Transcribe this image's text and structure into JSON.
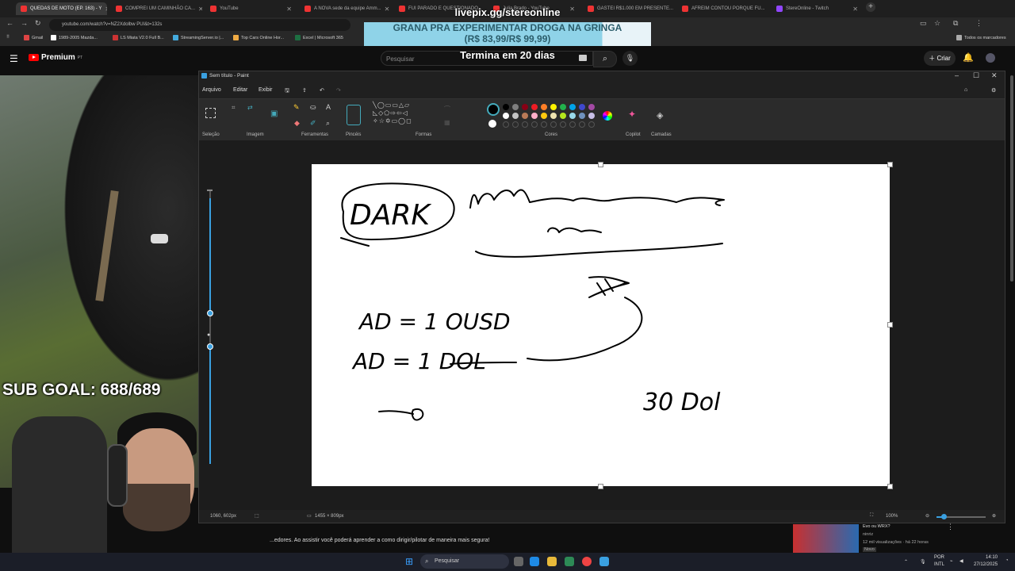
{
  "browser": {
    "tabs": [
      {
        "label": "QUEDAS DE MOTO (EP. 163) - Y",
        "active": true
      },
      {
        "label": "COMPREI UM CAMINHÃO CA...",
        "active": false
      },
      {
        "label": "YouTube",
        "active": false
      },
      {
        "label": "A NOVA sede da equipe Amm...",
        "active": false
      },
      {
        "label": "FUI PARADO E QUESTIONADO...",
        "active": false
      },
      {
        "label": "Julia Brado - YouTube",
        "active": false
      },
      {
        "label": "GASTEI R$1.000 EM PRESENTE...",
        "active": false
      },
      {
        "label": "AFREIM CONTOU PORQUE FU...",
        "active": false
      },
      {
        "label": "StereOnline - Twitch",
        "active": false
      }
    ],
    "url": "youtube.com/watch?v=NZ2Xdolbw PUI&t=132s",
    "bookmarks": [
      "Gmail",
      "1989-2005 Mazda...",
      "LS Miata V2.0 Full B...",
      "StreamingServer.io |...",
      "Top Cars Online Hor...",
      "Excel | Microsoft 365"
    ],
    "bookmarks_all": "Todos os marcadores"
  },
  "youtube": {
    "logo": "Premium",
    "logo_region": "PT",
    "search_placeholder": "Pesquisar",
    "create_label": "Criar",
    "description_snippet": "...edores. Ao assistir você poderá aprender a como dirigir/pilotar de maneira mais segura!",
    "recommended": {
      "title": "Evo ou WRX?",
      "channel": "ninriz",
      "meta": "12 mil visualizações · há 22 horas",
      "badge": "Novo"
    }
  },
  "stream_overlay": {
    "livepix": "livepix.gg/stereonline",
    "banner_line1": "GRANA PRA EXPERIMENTAR DROGA NA GRINGA",
    "banner_line2": "(R$ 83,99/R$ 99,99)",
    "countdown": "Termina em 20 dias",
    "sub_goal": "SUB GOAL: 688/689"
  },
  "paint": {
    "title": "Sem título - Paint",
    "menu": [
      "Arquivo",
      "Editar",
      "Exibir"
    ],
    "ribbon_groups": [
      "Seleção",
      "Imagem",
      "Ferramentas",
      "Pincéis",
      "Formas",
      "Cores",
      "Copilot",
      "Camadas"
    ],
    "palette": [
      "#000000",
      "#7f7f7f",
      "#880015",
      "#ed1c24",
      "#ff7f27",
      "#fff200",
      "#22b14c",
      "#00a2e8",
      "#3f48cc",
      "#a349a4",
      "#ffffff",
      "#c3c3c3",
      "#b97a57",
      "#ffaec9",
      "#ffc90e",
      "#efe4b0",
      "#b5e61d",
      "#99d9ea",
      "#7092be",
      "#c8bfe7"
    ],
    "status": {
      "cursor": "1060, 602px",
      "size": "1455 × 809px",
      "zoom": "100%"
    },
    "drawing_text": {
      "dark": "DARK",
      "eq1": "AD = 1 OUSD",
      "eq2": "AD = 1 DOL",
      "total": "30 Dol"
    }
  },
  "taskbar": {
    "search": "Pesquisar",
    "lang": "POR",
    "lang2": "INTL",
    "time": "14:10",
    "date": "27/12/2025"
  }
}
